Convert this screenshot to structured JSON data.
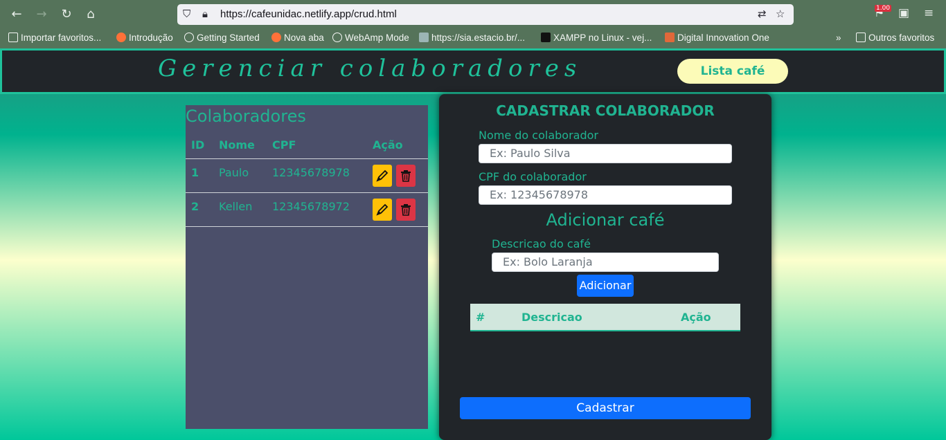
{
  "browser": {
    "url": "https://cafeunidac.netlify.app/crud.html",
    "badge": "1.00",
    "bookmarks": [
      {
        "label": "Importar favoritos..."
      },
      {
        "label": "Introdução"
      },
      {
        "label": "Getting Started"
      },
      {
        "label": "Nova aba"
      },
      {
        "label": "WebAmp Mode"
      },
      {
        "label": "https://sia.estacio.br/..."
      },
      {
        "label": "XAMPP no Linux - vej..."
      },
      {
        "label": "Digital Innovation One"
      }
    ],
    "other_bookmarks": "Outros favoritos"
  },
  "header": {
    "title": "Gerenciar colaboradores",
    "lista_cafe_label": "Lista café"
  },
  "colaboradores": {
    "title": "Colaboradores",
    "columns": [
      "ID",
      "Nome",
      "CPF",
      "Ação"
    ],
    "rows": [
      {
        "id": "1",
        "nome": "Paulo",
        "cpf": "12345678978"
      },
      {
        "id": "2",
        "nome": "Kellen",
        "cpf": "12345678972"
      }
    ]
  },
  "form": {
    "title": "CADASTRAR COLABORADOR",
    "nome_label": "Nome do colaborador",
    "nome_placeholder": "Ex: Paulo Silva",
    "cpf_label": "CPF do colaborador",
    "cpf_placeholder": "Ex: 12345678978",
    "cafe_title": "Adicionar café",
    "descricao_label": "Descricao do café",
    "descricao_placeholder": "Ex: Bolo Laranja",
    "adicionar_label": "Adicionar",
    "cafe_columns": [
      "#",
      "Descricao",
      "Ação"
    ],
    "cadastrar_label": "Cadastrar"
  },
  "colors": {
    "accent": "#20b491",
    "header_bg": "#212529",
    "panel_bg": "#4b4f6a",
    "primary": "#0d6efd",
    "edit": "#ffc107",
    "delete": "#dc3545"
  }
}
